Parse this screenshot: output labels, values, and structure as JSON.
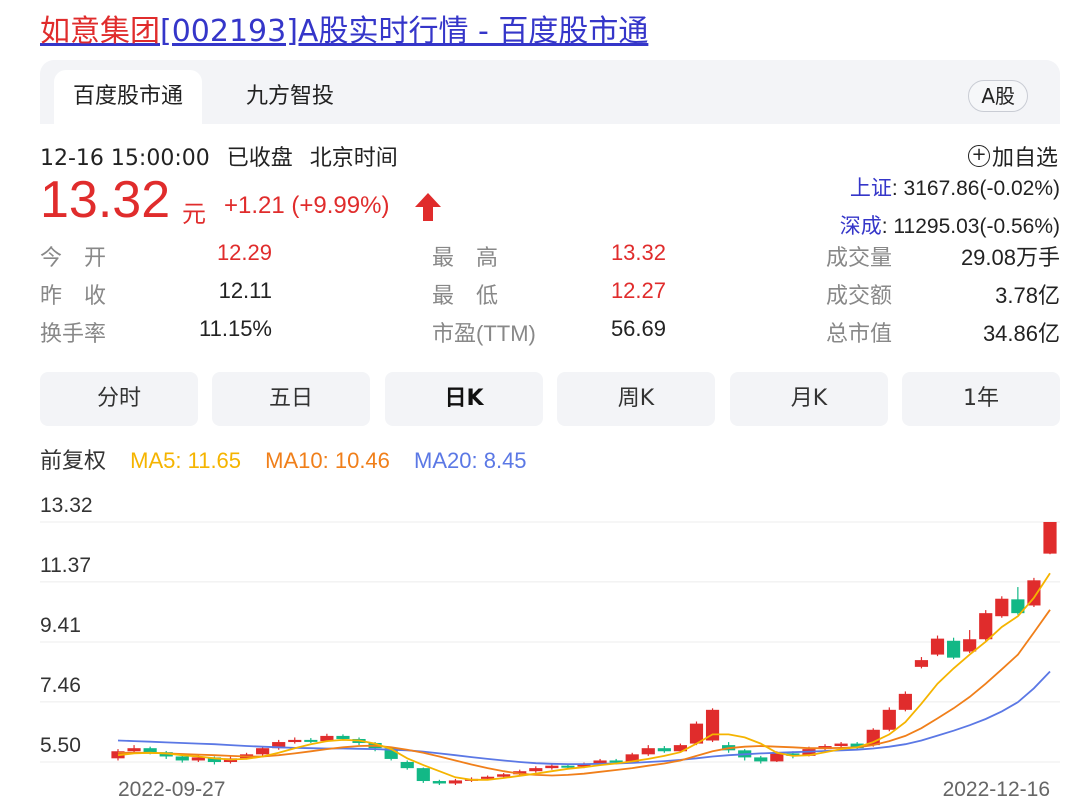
{
  "page_title": {
    "highlight": "如意集团",
    "rest": "[002193]A股实时行情 - 百度股市通"
  },
  "tabs": [
    {
      "label": "百度股市通",
      "active": true
    },
    {
      "label": "九方智投",
      "active": false
    }
  ],
  "market_badge": "A股",
  "status": {
    "datetime": "12-16 15:00:00",
    "state": "已收盘",
    "timezone": "北京时间"
  },
  "add_watch_label": "加自选",
  "quote": {
    "price": "13.32",
    "unit": "元",
    "change": "+1.21 (+9.99%)"
  },
  "indices": [
    {
      "name": "上证",
      "value": ": 3167.86(-0.02%)"
    },
    {
      "name": "深成",
      "value": ": 11295.03(-0.56%)"
    }
  ],
  "stats": {
    "open": {
      "label": "今　开",
      "value": "12.29"
    },
    "prev_close": {
      "label": "昨　收",
      "value": "12.11"
    },
    "turnover_rate": {
      "label": "换手率",
      "value": "11.15%"
    },
    "high": {
      "label": "最　高",
      "value": "13.32"
    },
    "low": {
      "label": "最　低",
      "value": "12.27"
    },
    "pe": {
      "label": "市盈(TTM)",
      "value": "56.69"
    },
    "volume": {
      "label": "成交量",
      "value": "29.08万手"
    },
    "amount": {
      "label": "成交额",
      "value": "3.78亿"
    },
    "market_cap": {
      "label": "总市值",
      "value": "34.86亿"
    }
  },
  "periods": [
    {
      "label": "分时",
      "active": false
    },
    {
      "label": "五日",
      "active": false
    },
    {
      "label": "日K",
      "active": true
    },
    {
      "label": "周K",
      "active": false
    },
    {
      "label": "月K",
      "active": false
    },
    {
      "label": "1年",
      "active": false
    }
  ],
  "ma": {
    "adjust": "前复权",
    "ma5": "MA5: 11.65",
    "ma10": "MA10: 10.46",
    "ma20": "MA20: 8.45"
  },
  "colors": {
    "up": "#e02c2c",
    "down": "#12b886",
    "link": "#3536c9",
    "ma5": "#f5b400",
    "ma10": "#f07f1a",
    "ma20": "#5b78e5"
  },
  "chart_data": {
    "type": "candlestick",
    "y_ticks": [
      "13.32",
      "11.37",
      "9.41",
      "7.46",
      "5.50"
    ],
    "ylim": [
      5.5,
      13.32
    ],
    "x_labels": [
      "2022-09-27",
      "2022-12-16"
    ],
    "grid": true,
    "candles": [
      {
        "o": 5.62,
        "c": 5.85,
        "h": 5.92,
        "l": 5.55
      },
      {
        "o": 5.85,
        "c": 5.95,
        "h": 6.05,
        "l": 5.78
      },
      {
        "o": 5.95,
        "c": 5.82,
        "h": 6.0,
        "l": 5.75
      },
      {
        "o": 5.82,
        "c": 5.68,
        "h": 5.86,
        "l": 5.6
      },
      {
        "o": 5.68,
        "c": 5.55,
        "h": 5.72,
        "l": 5.48
      },
      {
        "o": 5.55,
        "c": 5.65,
        "h": 5.72,
        "l": 5.5
      },
      {
        "o": 5.65,
        "c": 5.5,
        "h": 5.68,
        "l": 5.42
      },
      {
        "o": 5.5,
        "c": 5.62,
        "h": 5.7,
        "l": 5.45
      },
      {
        "o": 5.62,
        "c": 5.75,
        "h": 5.8,
        "l": 5.58
      },
      {
        "o": 5.75,
        "c": 5.95,
        "h": 6.0,
        "l": 5.7
      },
      {
        "o": 5.95,
        "c": 6.15,
        "h": 6.22,
        "l": 5.9
      },
      {
        "o": 6.15,
        "c": 6.22,
        "h": 6.3,
        "l": 6.1
      },
      {
        "o": 6.22,
        "c": 6.18,
        "h": 6.28,
        "l": 6.12
      },
      {
        "o": 6.18,
        "c": 6.35,
        "h": 6.42,
        "l": 6.15
      },
      {
        "o": 6.35,
        "c": 6.25,
        "h": 6.4,
        "l": 6.2
      },
      {
        "o": 6.25,
        "c": 6.12,
        "h": 6.3,
        "l": 6.05
      },
      {
        "o": 6.12,
        "c": 5.95,
        "h": 6.15,
        "l": 5.85
      },
      {
        "o": 5.95,
        "c": 5.6,
        "h": 5.98,
        "l": 5.55
      },
      {
        "o": 5.5,
        "c": 5.3,
        "h": 5.55,
        "l": 5.25
      },
      {
        "o": 5.3,
        "c": 4.88,
        "h": 5.32,
        "l": 4.82
      },
      {
        "o": 4.88,
        "c": 4.8,
        "h": 4.92,
        "l": 4.75
      },
      {
        "o": 4.8,
        "c": 4.9,
        "h": 4.95,
        "l": 4.75
      },
      {
        "o": 4.9,
        "c": 4.95,
        "h": 5.0,
        "l": 4.85
      },
      {
        "o": 4.95,
        "c": 5.02,
        "h": 5.06,
        "l": 4.9
      },
      {
        "o": 5.02,
        "c": 5.1,
        "h": 5.14,
        "l": 4.98
      },
      {
        "o": 5.1,
        "c": 5.2,
        "h": 5.25,
        "l": 5.05
      },
      {
        "o": 5.2,
        "c": 5.3,
        "h": 5.36,
        "l": 5.15
      },
      {
        "o": 5.3,
        "c": 5.38,
        "h": 5.42,
        "l": 5.25
      },
      {
        "o": 5.38,
        "c": 5.35,
        "h": 5.45,
        "l": 5.3
      },
      {
        "o": 5.35,
        "c": 5.42,
        "h": 5.48,
        "l": 5.3
      },
      {
        "o": 5.42,
        "c": 5.55,
        "h": 5.6,
        "l": 5.38
      },
      {
        "o": 5.55,
        "c": 5.48,
        "h": 5.6,
        "l": 5.42
      },
      {
        "o": 5.48,
        "c": 5.75,
        "h": 5.8,
        "l": 5.45
      },
      {
        "o": 5.75,
        "c": 5.95,
        "h": 6.05,
        "l": 5.7
      },
      {
        "o": 5.95,
        "c": 5.85,
        "h": 6.02,
        "l": 5.8
      },
      {
        "o": 5.85,
        "c": 6.05,
        "h": 6.1,
        "l": 5.82
      },
      {
        "o": 6.1,
        "c": 6.75,
        "h": 6.82,
        "l": 6.05
      },
      {
        "o": 6.2,
        "c": 7.2,
        "h": 7.25,
        "l": 6.15
      },
      {
        "o": 6.05,
        "c": 5.88,
        "h": 6.15,
        "l": 5.8
      },
      {
        "o": 5.88,
        "c": 5.65,
        "h": 5.92,
        "l": 5.55
      },
      {
        "o": 5.65,
        "c": 5.52,
        "h": 5.7,
        "l": 5.45
      },
      {
        "o": 5.52,
        "c": 5.78,
        "h": 5.85,
        "l": 5.5
      },
      {
        "o": 5.78,
        "c": 5.7,
        "h": 5.85,
        "l": 5.62
      },
      {
        "o": 5.7,
        "c": 5.92,
        "h": 6.0,
        "l": 5.68
      },
      {
        "o": 5.92,
        "c": 6.02,
        "h": 6.08,
        "l": 5.88
      },
      {
        "o": 6.02,
        "c": 6.1,
        "h": 6.15,
        "l": 5.98
      },
      {
        "o": 6.1,
        "c": 5.95,
        "h": 6.15,
        "l": 5.9
      },
      {
        "o": 6.05,
        "c": 6.55,
        "h": 6.6,
        "l": 6.0
      },
      {
        "o": 6.55,
        "c": 7.2,
        "h": 7.28,
        "l": 6.5
      },
      {
        "o": 7.2,
        "c": 7.72,
        "h": 7.8,
        "l": 7.15
      },
      {
        "o": 8.6,
        "c": 8.82,
        "h": 8.92,
        "l": 8.55
      },
      {
        "o": 9.0,
        "c": 9.52,
        "h": 9.62,
        "l": 8.95
      },
      {
        "o": 9.45,
        "c": 8.9,
        "h": 9.55,
        "l": 8.85
      },
      {
        "o": 9.1,
        "c": 9.5,
        "h": 9.8,
        "l": 9.05
      },
      {
        "o": 9.5,
        "c": 10.35,
        "h": 10.45,
        "l": 9.45
      },
      {
        "o": 10.25,
        "c": 10.82,
        "h": 10.9,
        "l": 10.2
      },
      {
        "o": 10.8,
        "c": 10.35,
        "h": 11.2,
        "l": 10.3
      },
      {
        "o": 10.6,
        "c": 11.42,
        "h": 11.5,
        "l": 10.55
      },
      {
        "o": 12.29,
        "c": 13.32,
        "h": 13.32,
        "l": 12.27
      }
    ],
    "ma5": [
      5.72,
      5.78,
      5.8,
      5.78,
      5.72,
      5.68,
      5.62,
      5.58,
      5.6,
      5.68,
      5.8,
      5.95,
      6.08,
      6.18,
      6.22,
      6.2,
      6.1,
      5.92,
      5.62,
      5.4,
      5.2,
      5.0,
      4.92,
      4.92,
      4.98,
      5.05,
      5.12,
      5.2,
      5.28,
      5.33,
      5.4,
      5.45,
      5.52,
      5.6,
      5.7,
      5.82,
      6.1,
      6.4,
      6.4,
      6.3,
      6.1,
      5.8,
      5.7,
      5.72,
      5.82,
      5.92,
      5.98,
      6.15,
      6.4,
      6.8,
      7.4,
      8.05,
      8.55,
      9.0,
      9.42,
      9.9,
      10.25,
      10.85,
      11.65
    ],
    "ma10": [
      5.8,
      5.8,
      5.8,
      5.78,
      5.76,
      5.74,
      5.72,
      5.7,
      5.68,
      5.68,
      5.72,
      5.78,
      5.85,
      5.92,
      5.98,
      6.02,
      6.03,
      5.98,
      5.9,
      5.8,
      5.68,
      5.55,
      5.42,
      5.3,
      5.2,
      5.12,
      5.08,
      5.06,
      5.08,
      5.12,
      5.18,
      5.24,
      5.3,
      5.38,
      5.45,
      5.55,
      5.7,
      5.85,
      5.95,
      6.0,
      6.02,
      6.0,
      5.98,
      5.95,
      5.95,
      5.96,
      5.98,
      6.05,
      6.18,
      6.35,
      6.6,
      6.92,
      7.25,
      7.62,
      8.05,
      8.52,
      9.0,
      9.72,
      10.46
    ],
    "ma20": [
      6.2,
      6.18,
      6.16,
      6.14,
      6.12,
      6.1,
      6.08,
      6.05,
      6.02,
      6.0,
      5.98,
      5.96,
      5.95,
      5.94,
      5.94,
      5.93,
      5.92,
      5.9,
      5.88,
      5.84,
      5.78,
      5.72,
      5.66,
      5.6,
      5.55,
      5.5,
      5.46,
      5.44,
      5.43,
      5.43,
      5.44,
      5.45,
      5.47,
      5.5,
      5.53,
      5.57,
      5.62,
      5.68,
      5.72,
      5.75,
      5.78,
      5.8,
      5.82,
      5.84,
      5.86,
      5.88,
      5.9,
      5.94,
      6.0,
      6.08,
      6.2,
      6.36,
      6.52,
      6.7,
      6.9,
      7.15,
      7.45,
      7.9,
      8.45
    ]
  }
}
